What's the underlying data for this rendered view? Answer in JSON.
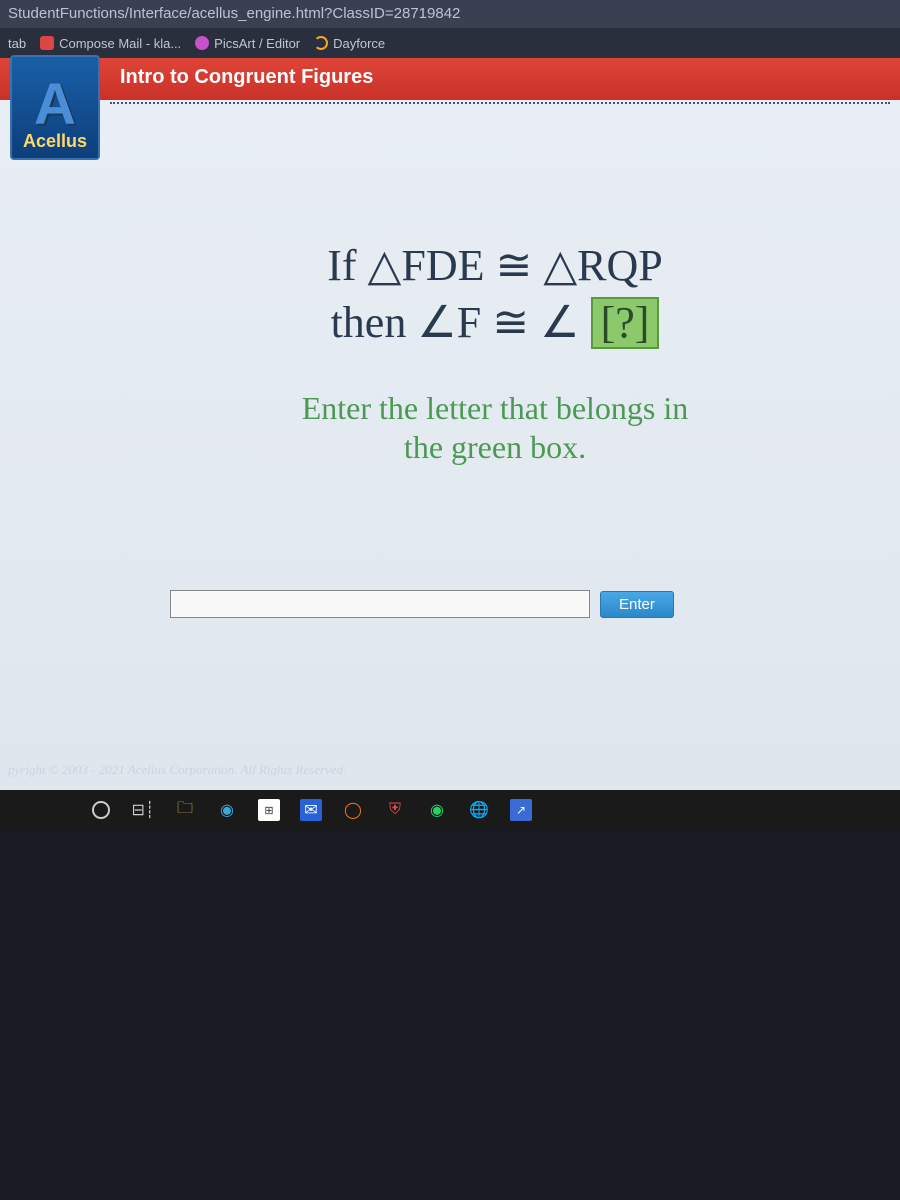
{
  "url": "StudentFunctions/Interface/acellus_engine.html?ClassID=28719842",
  "bookmarks": [
    {
      "label": "tab",
      "color": ""
    },
    {
      "label": "Compose Mail - kla...",
      "color": "#d44"
    },
    {
      "label": "PicsArt / Editor",
      "color": "#c850c8"
    },
    {
      "label": "Dayforce",
      "color": "#f5a623"
    }
  ],
  "header": {
    "title": "Intro to Congruent Figures"
  },
  "logo": {
    "letter": "A",
    "brand": "Acellus"
  },
  "question": {
    "line1_prefix": "If  △FDE  ≅  △RQP",
    "line2_prefix": "then  ∠F  ≅  ∠",
    "box_content": "[?]",
    "instruction_l1": "Enter the letter that belongs in",
    "instruction_l2": "the green box."
  },
  "input": {
    "value": "",
    "button": "Enter"
  },
  "footer": {
    "copyright": "pyright © 2003 - 2021 Acellus Corporation. All Rights Reserved."
  },
  "taskbar": {
    "icons": [
      "cortana",
      "taskview",
      "explorer",
      "edge",
      "store",
      "mail",
      "app1",
      "shield",
      "spotify",
      "chrome",
      "share"
    ]
  }
}
